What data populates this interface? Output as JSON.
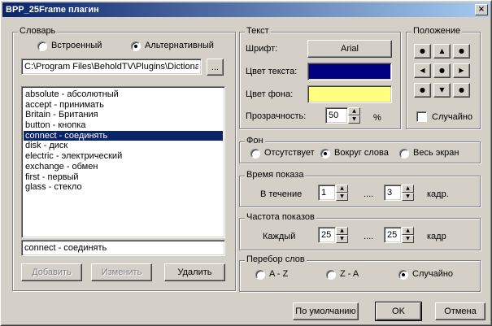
{
  "window": {
    "title": "BPP_25Frame плагин",
    "close_glyph": "×"
  },
  "dictionary": {
    "group_label": "Словарь",
    "radio_builtin": "Встроенный",
    "radio_alternative": "Альтернативный",
    "selected_source": "alternative",
    "path_value": "C:\\Program Files\\BeholdTV\\Plugins\\Dictionar",
    "browse_label": "...",
    "items": [
      "absolute - абсолютный",
      "accept - принимать",
      "Britain - Британия",
      "button - кнопка",
      "connect - соединять",
      "disk - диск",
      "electric - электрический",
      "exchange - обмен",
      "first - первый",
      "glass - стекло"
    ],
    "selected_index": 4,
    "edit_value": "connect - соединять",
    "add_label": "Добавить",
    "modify_label": "Изменить",
    "delete_label": "Удалить"
  },
  "text": {
    "group_label": "Текст",
    "font_label": "Шрифт:",
    "font_button": "Arial",
    "text_color_label": "Цвет текста:",
    "text_color": "#000080",
    "bg_color_label": "Цвет фона:",
    "bg_color": "#ffff80",
    "transparency_label": "Прозрачность:",
    "transparency_value": "50",
    "transparency_unit": "%"
  },
  "position": {
    "group_label": "Положение",
    "random_label": "Случайно",
    "random_checked": false,
    "glyphs": [
      "●",
      "▲",
      "●",
      "◀",
      "●",
      "▶",
      "●",
      "▼",
      "●"
    ]
  },
  "background": {
    "group_label": "Фон",
    "options": [
      "Отсутствует",
      "Вокруг слова",
      "Весь экран"
    ],
    "selected_index": 1
  },
  "show_time": {
    "group_label": "Время показа",
    "during_label": "В течение",
    "from_value": "1",
    "dots": "....",
    "to_value": "3",
    "unit": "кадр."
  },
  "frequency": {
    "group_label": "Частота показов",
    "each_label": "Каждый",
    "from_value": "25",
    "dots": "....",
    "to_value": "25",
    "unit": "кадр"
  },
  "word_order": {
    "group_label": "Перебор слов",
    "options": [
      "A - Z",
      "Z - A",
      "Случайно"
    ],
    "selected_index": 2
  },
  "footer": {
    "defaults_label": "По умолчанию",
    "ok_label": "OK",
    "cancel_label": "Отмена"
  }
}
